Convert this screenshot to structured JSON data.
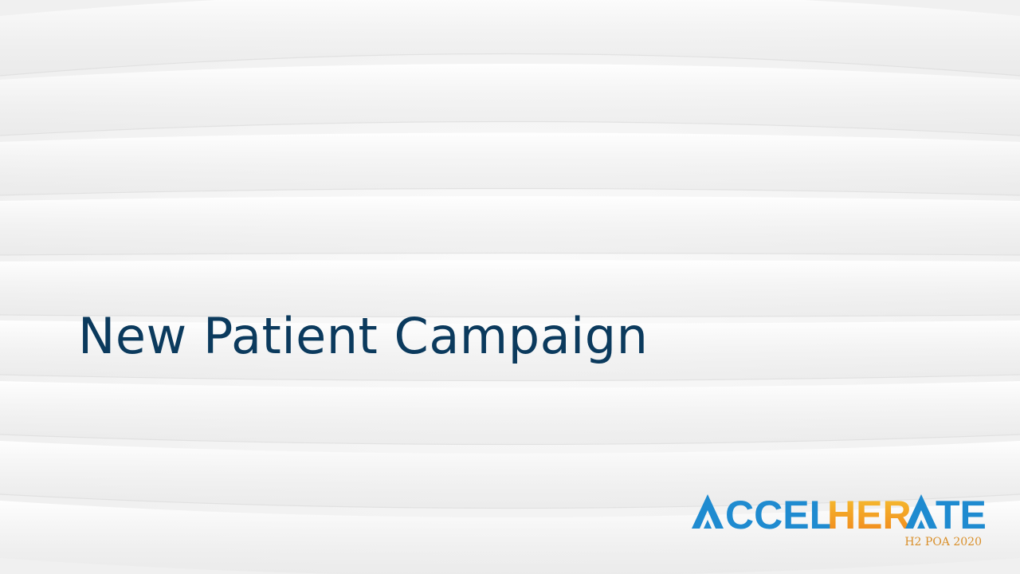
{
  "slide": {
    "title": "New Patient Campaign"
  },
  "logo": {
    "wordmark_part1": "ACCEL",
    "wordmark_part2": "HER",
    "wordmark_part3": "ATE",
    "tagline": "H2 POA 2020"
  },
  "colors": {
    "title": "#0b3a5d",
    "logo_blue": "#1f8bd0",
    "logo_orange": "#f29a1f",
    "logo_gold": "#f6c030",
    "tagline": "#d98f2a",
    "background": "#f6f6f6"
  }
}
